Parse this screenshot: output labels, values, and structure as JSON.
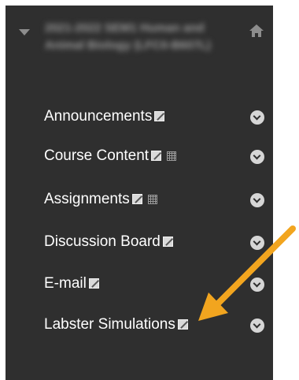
{
  "course": {
    "title": "2021-2022 SEM1 Human and Animal Biology (LFC0-B607L)"
  },
  "menu": {
    "items": [
      {
        "label": "Announcements",
        "grid": false
      },
      {
        "label": "Course Content",
        "grid": true
      },
      {
        "label": "Assignments",
        "grid": true
      },
      {
        "label": "Discussion Board",
        "grid": false
      },
      {
        "label": "E-mail",
        "grid": false
      },
      {
        "label": "Labster Simulations",
        "grid": false
      }
    ]
  },
  "icons": {
    "collapse": "caret-down-icon",
    "home": "home-icon",
    "edit": "edit-icon",
    "grid": "grid-icon",
    "chevron": "chevron-down-icon",
    "pointer": "arrow-annotation-icon"
  },
  "colors": {
    "panel": "#2f2f2f",
    "arrow": "#f2a51f",
    "text": "#ffffff"
  }
}
